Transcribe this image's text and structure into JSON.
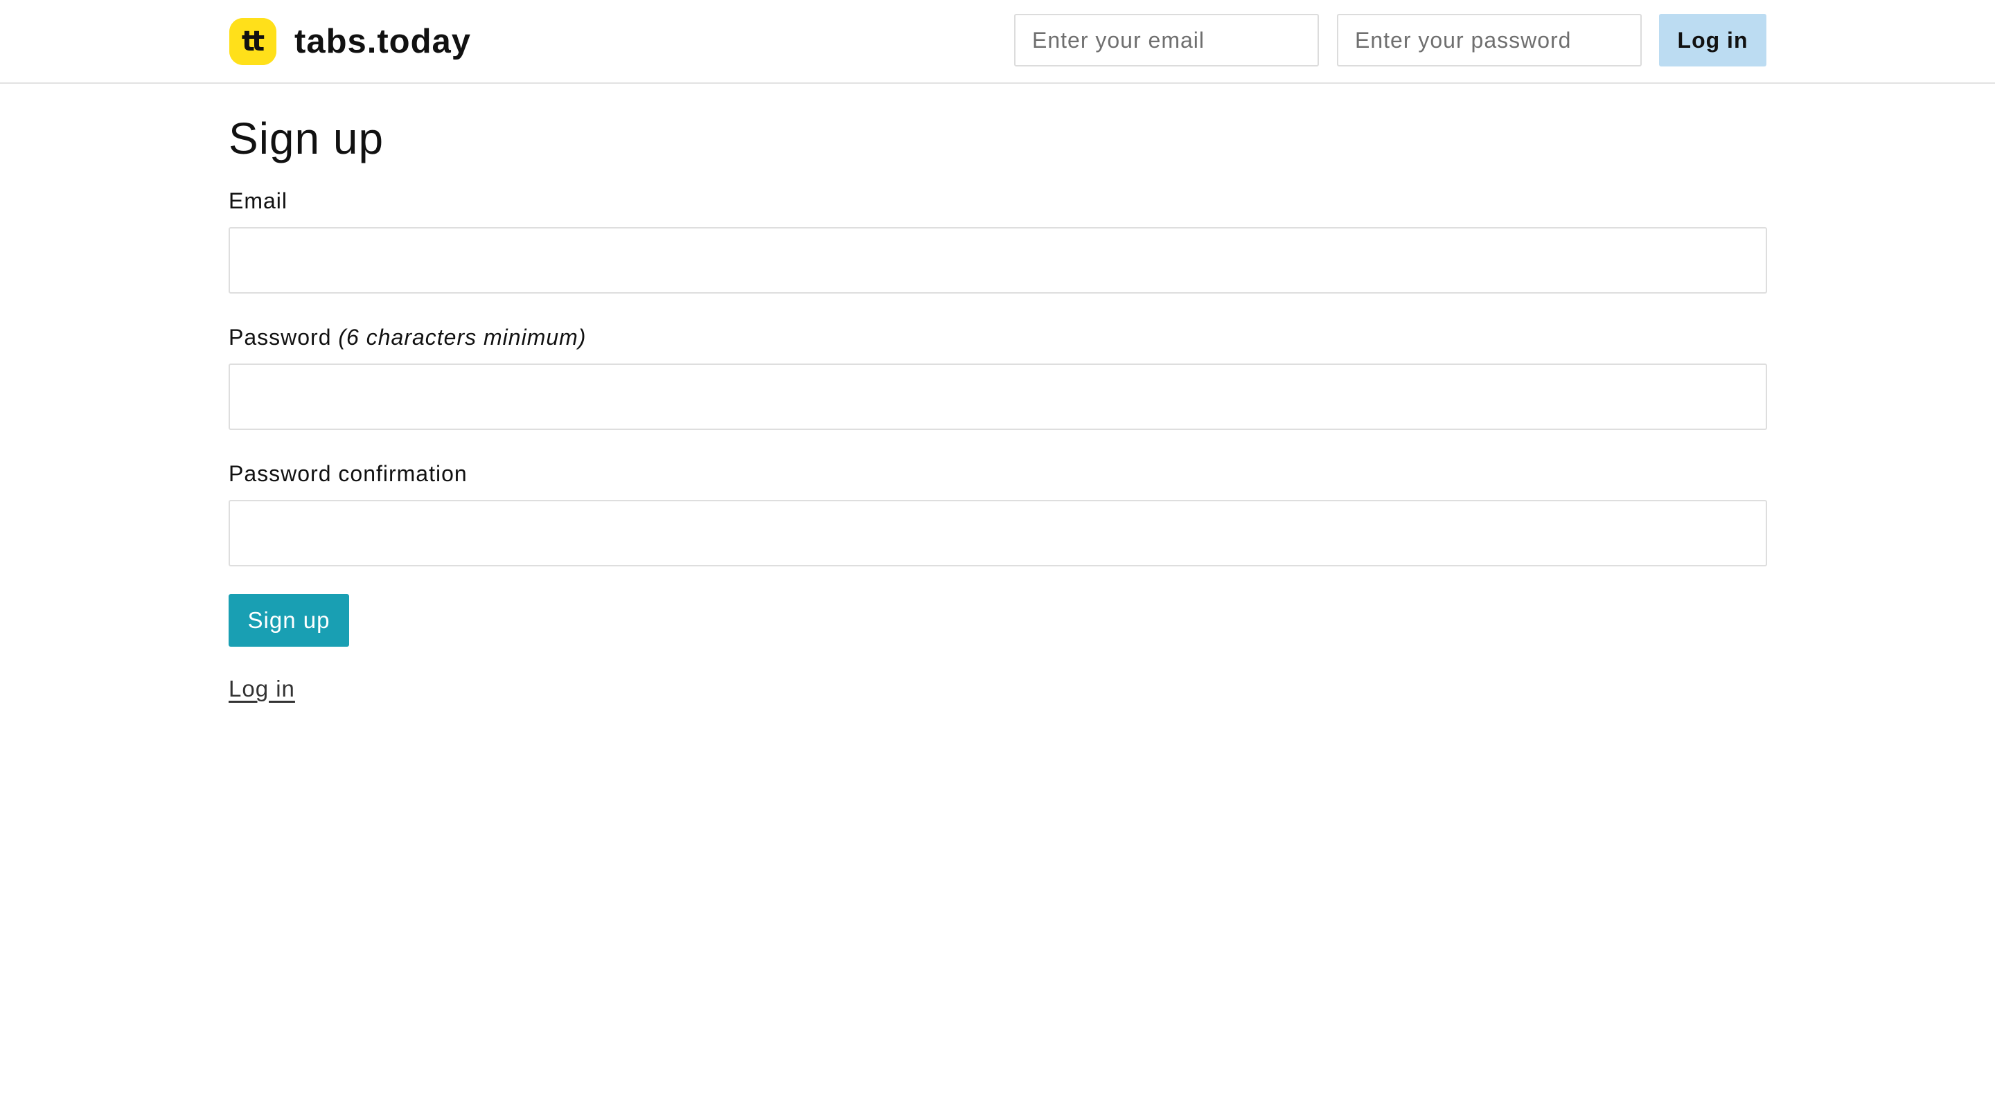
{
  "header": {
    "logo_text": "tt",
    "brand_name": "tabs.today",
    "email_placeholder": "Enter your email",
    "password_placeholder": "Enter your password",
    "login_button": "Log in"
  },
  "form": {
    "title": "Sign up",
    "email_label": "Email",
    "email_value": "",
    "password_label": "Password",
    "password_hint": "(6 characters minimum)",
    "password_value": "",
    "confirm_label": "Password confirmation",
    "confirm_value": "",
    "submit_label": "Sign up",
    "login_link": "Log in"
  },
  "colors": {
    "logo_bg": "#ffe01a",
    "header_login_bg": "#bcdcf2",
    "signup_button_bg": "#199fb3"
  }
}
